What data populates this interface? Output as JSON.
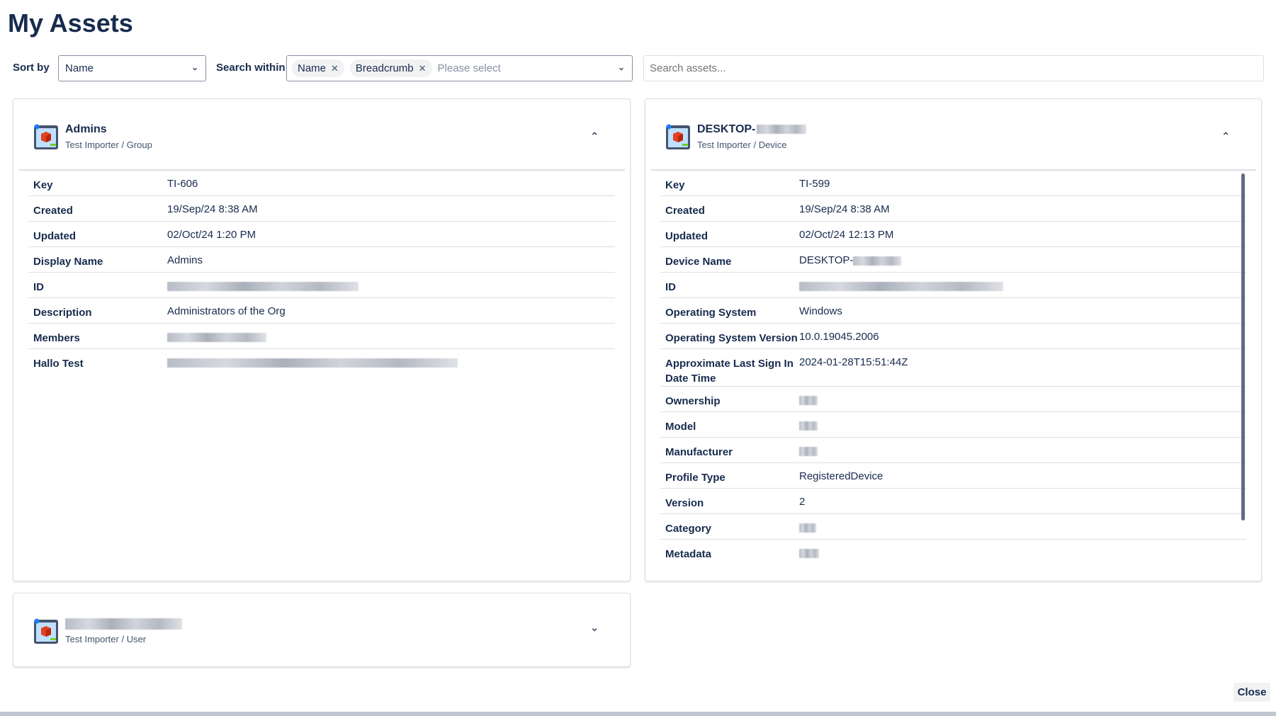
{
  "page": {
    "title": "My Assets",
    "close_label": "Close"
  },
  "toolbar": {
    "sort_label": "Sort by",
    "sort_value": "Name",
    "search_within_label": "Search within",
    "search_within_tags": [
      "Name",
      "Breadcrumb"
    ],
    "search_within_placeholder": "Please select",
    "search_placeholder": "Search assets..."
  },
  "cards": [
    {
      "title": "Admins",
      "subtitle": "Test Importer / Group",
      "expanded": true,
      "icon": "object-type-icon",
      "rows": [
        {
          "k": "Key",
          "v": "TI-606"
        },
        {
          "k": "Created",
          "v": "19/Sep/24 8:38 AM"
        },
        {
          "k": "Updated",
          "v": "02/Oct/24 1:20 PM"
        },
        {
          "k": "Display Name",
          "v": "Admins"
        },
        {
          "k": "ID",
          "redacted": true
        },
        {
          "k": "Description",
          "v": "Administrators of the Org"
        },
        {
          "k": "Members",
          "redacted": true
        },
        {
          "k": "Hallo Test",
          "redacted": true
        }
      ]
    },
    {
      "title": "DESKTOP-",
      "subtitle": "Test Importer / Device",
      "expanded": true,
      "icon": "object-type-icon",
      "rows": [
        {
          "k": "Key",
          "v": "TI-599"
        },
        {
          "k": "Created",
          "v": "19/Sep/24 8:38 AM"
        },
        {
          "k": "Updated",
          "v": "02/Oct/24 12:13 PM"
        },
        {
          "k": "Device Name",
          "v": "DESKTOP-",
          "redacted_suffix": true
        },
        {
          "k": "ID",
          "redacted": true
        },
        {
          "k": "Operating System",
          "v": "Windows"
        },
        {
          "k": "Operating System Version",
          "v": "10.0.19045.2006"
        },
        {
          "k": "Approximate Last Sign In Date Time",
          "v": "2024-01-28T15:51:44Z"
        },
        {
          "k": "Ownership",
          "redacted": true
        },
        {
          "k": "Model",
          "redacted": true
        },
        {
          "k": "Manufacturer",
          "redacted": true
        },
        {
          "k": "Profile Type",
          "v": "RegisteredDevice"
        },
        {
          "k": "Version",
          "v": "2"
        },
        {
          "k": "Category",
          "redacted": true
        },
        {
          "k": "Metadata",
          "redacted": true
        }
      ]
    },
    {
      "title": "",
      "subtitle": "Test Importer / User",
      "expanded": false,
      "icon": "object-type-icon",
      "rows": []
    }
  ]
}
